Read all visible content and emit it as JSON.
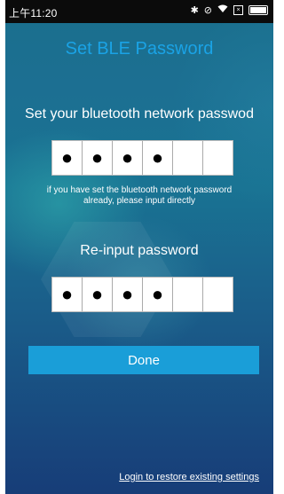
{
  "status_bar": {
    "time": "上午11:20",
    "icons": [
      "bluetooth-icon",
      "no-signal-icon",
      "wifi-icon",
      "sim-icon",
      "battery-icon"
    ]
  },
  "header": {
    "title": "Set BLE Password"
  },
  "form": {
    "heading": "Set your bluetooth network passwod",
    "password_cells": [
      "●",
      "●",
      "●",
      "●",
      "",
      ""
    ],
    "hint_line1": "if you have set the bluetooth network password",
    "hint_line2": "already, please input directly",
    "reinput_heading": "Re-input password",
    "reinput_cells": [
      "●",
      "●",
      "●",
      "●",
      "",
      ""
    ],
    "done_label": "Done"
  },
  "footer": {
    "login_link": "Login to restore existing settings"
  },
  "colors": {
    "title": "#1aa3e6",
    "button": "#1a9ed8",
    "background_top": "#1a6f8d",
    "background_bottom": "#173d78"
  }
}
